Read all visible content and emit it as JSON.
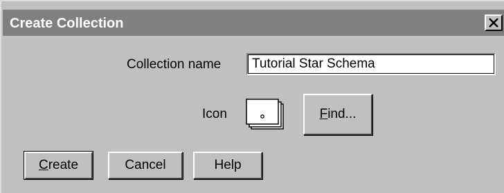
{
  "window": {
    "title": "Create Collection",
    "close_label": "X"
  },
  "form": {
    "collection_name_label": "Collection name",
    "collection_name_value": "Tutorial Star Schema",
    "icon_label": "Icon",
    "find_button_label": "Find..."
  },
  "buttons": {
    "create_label": "Create",
    "cancel_label": "Cancel",
    "help_label": "Help"
  },
  "colors": {
    "dialog_face": "#c0c0c0",
    "titlebar": "#808080",
    "title_text": "#ffffff"
  }
}
